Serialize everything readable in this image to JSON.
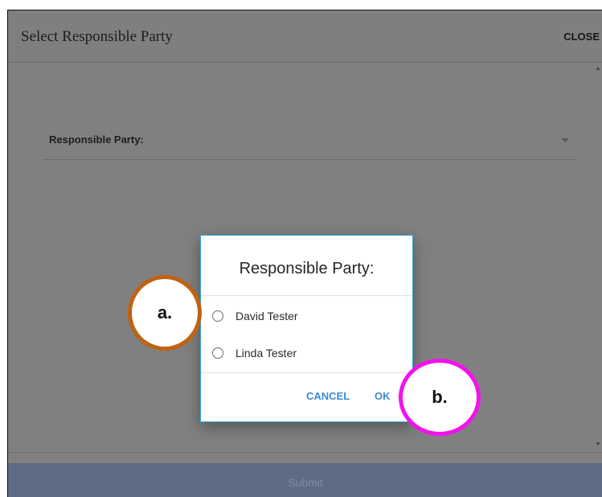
{
  "header": {
    "title": "Select Responsible Party",
    "close_label": "CLOSE"
  },
  "form": {
    "field_label": "Responsible Party:"
  },
  "footer": {
    "submit_label": "Submit"
  },
  "dialog": {
    "title": "Responsible Party:",
    "options": [
      {
        "label": "David Tester",
        "selected": false
      },
      {
        "label": "Linda Tester",
        "selected": false
      }
    ],
    "cancel_label": "CANCEL",
    "ok_label": "OK"
  },
  "annotations": {
    "a": "a.",
    "b": "b."
  },
  "colors": {
    "overlay": "#808080",
    "dialog_border": "#2fa6d8",
    "button_text": "#3a8ad8",
    "submit_bg": "#5e6b85",
    "marker_a": "#c0620f",
    "marker_b": "#f411ee"
  },
  "icons": {
    "dropdown": "chevron-down-icon",
    "radio": "radio-unchecked-icon"
  }
}
